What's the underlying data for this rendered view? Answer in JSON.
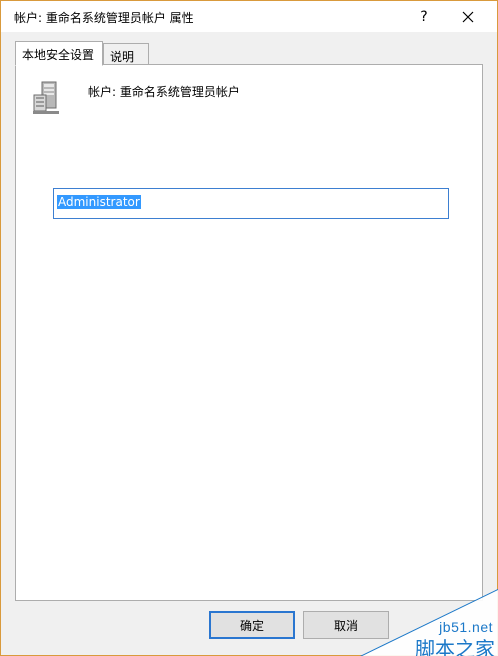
{
  "window": {
    "title": "帐户: 重命名系统管理员帐户 属性",
    "help_label": "?"
  },
  "tabs": [
    {
      "label": "本地安全设置",
      "active": true
    },
    {
      "label": "说明",
      "active": false
    }
  ],
  "panel": {
    "header_label": "帐户: 重命名系统管理员帐户",
    "input_value": "Administrator",
    "icon": "server-icon"
  },
  "footer": {
    "ok_label": "确定",
    "cancel_label": "取消"
  },
  "watermark": {
    "site": "jb51.net",
    "brand": "脚本之家"
  },
  "colors": {
    "accent": "#2a76d0",
    "selection": "#3399ff",
    "frame": "#d99a3c",
    "watermark": "#1b78c8"
  }
}
